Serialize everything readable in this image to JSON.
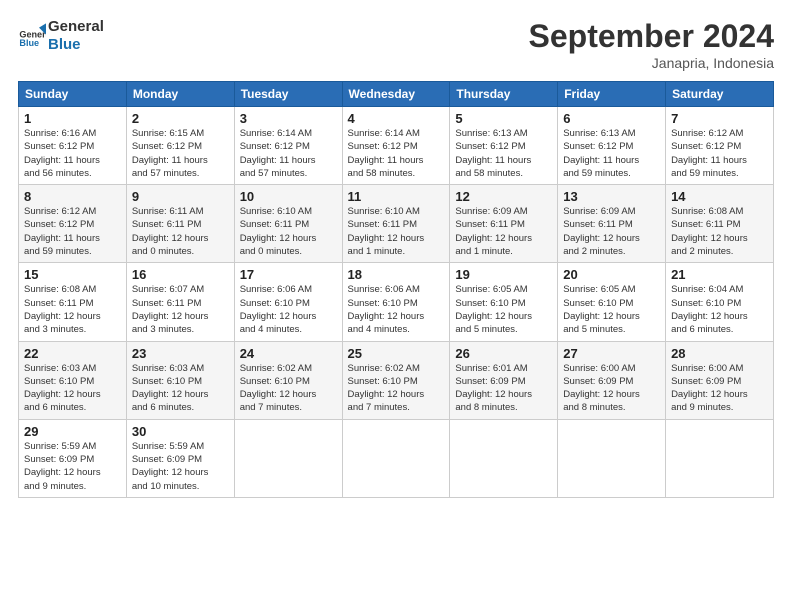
{
  "logo": {
    "line1": "General",
    "line2": "Blue"
  },
  "header": {
    "title": "September 2024",
    "subtitle": "Janapria, Indonesia"
  },
  "weekdays": [
    "Sunday",
    "Monday",
    "Tuesday",
    "Wednesday",
    "Thursday",
    "Friday",
    "Saturday"
  ],
  "weeks": [
    [
      {
        "day": 1,
        "info": "Sunrise: 6:16 AM\nSunset: 6:12 PM\nDaylight: 11 hours\nand 56 minutes."
      },
      {
        "day": 2,
        "info": "Sunrise: 6:15 AM\nSunset: 6:12 PM\nDaylight: 11 hours\nand 57 minutes."
      },
      {
        "day": 3,
        "info": "Sunrise: 6:14 AM\nSunset: 6:12 PM\nDaylight: 11 hours\nand 57 minutes."
      },
      {
        "day": 4,
        "info": "Sunrise: 6:14 AM\nSunset: 6:12 PM\nDaylight: 11 hours\nand 58 minutes."
      },
      {
        "day": 5,
        "info": "Sunrise: 6:13 AM\nSunset: 6:12 PM\nDaylight: 11 hours\nand 58 minutes."
      },
      {
        "day": 6,
        "info": "Sunrise: 6:13 AM\nSunset: 6:12 PM\nDaylight: 11 hours\nand 59 minutes."
      },
      {
        "day": 7,
        "info": "Sunrise: 6:12 AM\nSunset: 6:12 PM\nDaylight: 11 hours\nand 59 minutes."
      }
    ],
    [
      {
        "day": 8,
        "info": "Sunrise: 6:12 AM\nSunset: 6:12 PM\nDaylight: 11 hours\nand 59 minutes."
      },
      {
        "day": 9,
        "info": "Sunrise: 6:11 AM\nSunset: 6:11 PM\nDaylight: 12 hours\nand 0 minutes."
      },
      {
        "day": 10,
        "info": "Sunrise: 6:10 AM\nSunset: 6:11 PM\nDaylight: 12 hours\nand 0 minutes."
      },
      {
        "day": 11,
        "info": "Sunrise: 6:10 AM\nSunset: 6:11 PM\nDaylight: 12 hours\nand 1 minute."
      },
      {
        "day": 12,
        "info": "Sunrise: 6:09 AM\nSunset: 6:11 PM\nDaylight: 12 hours\nand 1 minute."
      },
      {
        "day": 13,
        "info": "Sunrise: 6:09 AM\nSunset: 6:11 PM\nDaylight: 12 hours\nand 2 minutes."
      },
      {
        "day": 14,
        "info": "Sunrise: 6:08 AM\nSunset: 6:11 PM\nDaylight: 12 hours\nand 2 minutes."
      }
    ],
    [
      {
        "day": 15,
        "info": "Sunrise: 6:08 AM\nSunset: 6:11 PM\nDaylight: 12 hours\nand 3 minutes."
      },
      {
        "day": 16,
        "info": "Sunrise: 6:07 AM\nSunset: 6:11 PM\nDaylight: 12 hours\nand 3 minutes."
      },
      {
        "day": 17,
        "info": "Sunrise: 6:06 AM\nSunset: 6:10 PM\nDaylight: 12 hours\nand 4 minutes."
      },
      {
        "day": 18,
        "info": "Sunrise: 6:06 AM\nSunset: 6:10 PM\nDaylight: 12 hours\nand 4 minutes."
      },
      {
        "day": 19,
        "info": "Sunrise: 6:05 AM\nSunset: 6:10 PM\nDaylight: 12 hours\nand 5 minutes."
      },
      {
        "day": 20,
        "info": "Sunrise: 6:05 AM\nSunset: 6:10 PM\nDaylight: 12 hours\nand 5 minutes."
      },
      {
        "day": 21,
        "info": "Sunrise: 6:04 AM\nSunset: 6:10 PM\nDaylight: 12 hours\nand 6 minutes."
      }
    ],
    [
      {
        "day": 22,
        "info": "Sunrise: 6:03 AM\nSunset: 6:10 PM\nDaylight: 12 hours\nand 6 minutes."
      },
      {
        "day": 23,
        "info": "Sunrise: 6:03 AM\nSunset: 6:10 PM\nDaylight: 12 hours\nand 6 minutes."
      },
      {
        "day": 24,
        "info": "Sunrise: 6:02 AM\nSunset: 6:10 PM\nDaylight: 12 hours\nand 7 minutes."
      },
      {
        "day": 25,
        "info": "Sunrise: 6:02 AM\nSunset: 6:10 PM\nDaylight: 12 hours\nand 7 minutes."
      },
      {
        "day": 26,
        "info": "Sunrise: 6:01 AM\nSunset: 6:09 PM\nDaylight: 12 hours\nand 8 minutes."
      },
      {
        "day": 27,
        "info": "Sunrise: 6:00 AM\nSunset: 6:09 PM\nDaylight: 12 hours\nand 8 minutes."
      },
      {
        "day": 28,
        "info": "Sunrise: 6:00 AM\nSunset: 6:09 PM\nDaylight: 12 hours\nand 9 minutes."
      }
    ],
    [
      {
        "day": 29,
        "info": "Sunrise: 5:59 AM\nSunset: 6:09 PM\nDaylight: 12 hours\nand 9 minutes."
      },
      {
        "day": 30,
        "info": "Sunrise: 5:59 AM\nSunset: 6:09 PM\nDaylight: 12 hours\nand 10 minutes."
      },
      null,
      null,
      null,
      null,
      null
    ]
  ]
}
